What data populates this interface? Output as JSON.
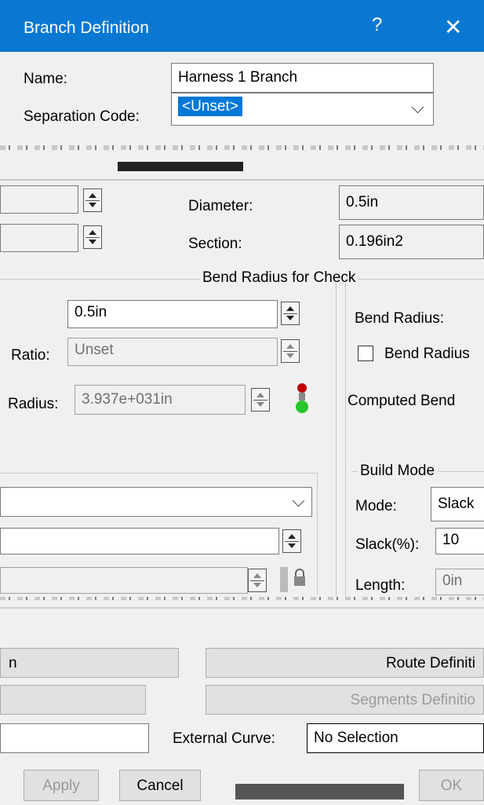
{
  "dialog": {
    "title": "Branch Definition",
    "help": "?",
    "close": "✕"
  },
  "name_field": {
    "label": "Name:",
    "value": "Harness 1 Branch"
  },
  "separation_code": {
    "label": "Separation Code:",
    "value": "<Unset>"
  },
  "diameter": {
    "label": "Diameter:",
    "value": "0.5in"
  },
  "section": {
    "label": "Section:",
    "value": "0.196in2"
  },
  "bend_group": {
    "title": "Bend Radius for Check"
  },
  "bend_left": {
    "radius_value": "0.5in",
    "ratio_label": "Ratio:",
    "ratio_value": "Unset",
    "radius_label": "Radius:",
    "computed_value": "3.937e+031in"
  },
  "bend_right": {
    "bend_radius_label": "Bend Radius:",
    "bend_radius_check": "Bend Radius",
    "computed_label": "Computed Bend"
  },
  "build_mode": {
    "title": "Build Mode",
    "mode_label": "Mode:",
    "mode_value": "Slack",
    "slack_label": "Slack(%):",
    "slack_value": "10",
    "length_label": "Length:",
    "length_value": "0in"
  },
  "route_buttons": {
    "left_fragment": "n",
    "route_definition": "Route Definiti",
    "segments": "Segments Definitio"
  },
  "external_curve": {
    "label": "External Curve:",
    "value": "No Selection"
  },
  "footer": {
    "apply": "Apply",
    "cancel": "Cancel",
    "ok": "OK"
  },
  "colors": {
    "title_bar": "#0a78d2",
    "selection": "#0078d7"
  },
  "icons": {
    "status": "traffic-light-icon",
    "lock": "lock-icon"
  }
}
